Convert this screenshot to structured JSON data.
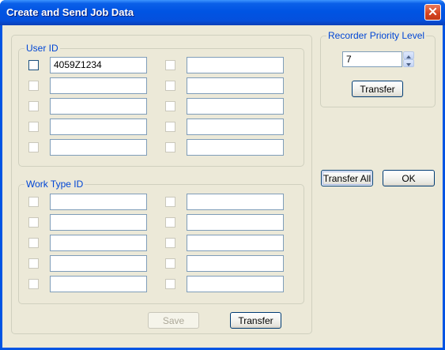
{
  "window": {
    "title": "Create and Send Job Data"
  },
  "user_id_group": {
    "label": "User ID",
    "rows": [
      {
        "left": "4059Z1234",
        "right": ""
      },
      {
        "left": "",
        "right": ""
      },
      {
        "left": "",
        "right": ""
      },
      {
        "left": "",
        "right": ""
      },
      {
        "left": "",
        "right": ""
      }
    ]
  },
  "work_type_group": {
    "label": "Work Type ID",
    "rows": [
      {
        "left": "",
        "right": ""
      },
      {
        "left": "",
        "right": ""
      },
      {
        "left": "",
        "right": ""
      },
      {
        "left": "",
        "right": ""
      },
      {
        "left": "",
        "right": ""
      }
    ]
  },
  "priority": {
    "label": "Recorder Priority Level",
    "value": "7",
    "transfer_label": "Transfer"
  },
  "buttons": {
    "save": "Save",
    "transfer": "Transfer",
    "transfer_all": "Transfer All",
    "ok": "OK"
  },
  "icons": {
    "close": "close-icon",
    "spin_up": "arrow-up-icon",
    "spin_down": "arrow-down-icon"
  },
  "colors": {
    "titlebar": "#0054e3",
    "close": "#d5431f",
    "dialog_bg": "#ece9d8",
    "group_label": "#0046d5"
  }
}
